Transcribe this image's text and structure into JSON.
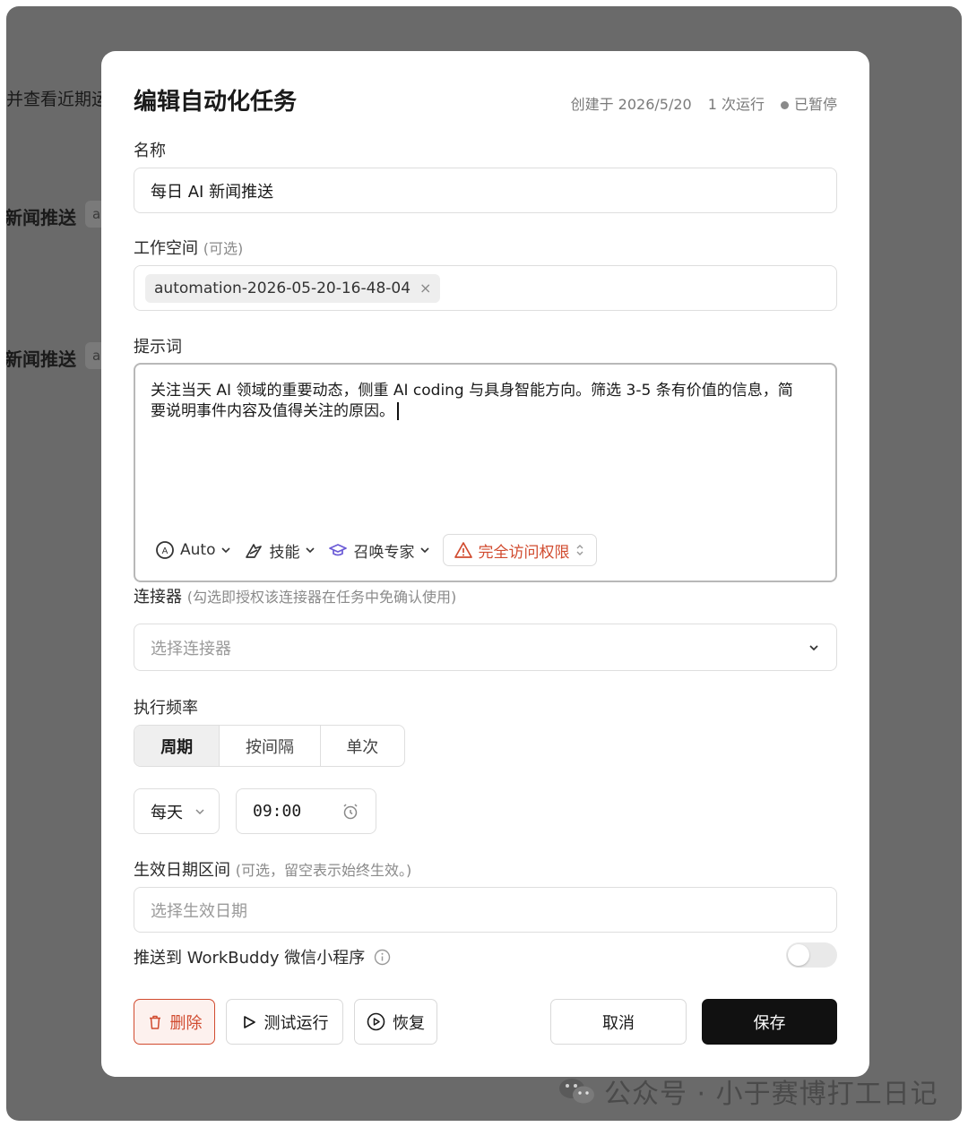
{
  "background": {
    "text_top": "并查看近期运",
    "item1_name": "新闻推送",
    "item1_chip": "a",
    "item2_name": "新闻推送",
    "item2_chip": "a"
  },
  "watermark": "公众号 · 小于赛博打工日记",
  "modal": {
    "title": "编辑自动化任务",
    "meta": {
      "created": "创建于 2026/5/20",
      "runs": "1 次运行",
      "status": "已暂停"
    },
    "name_field": {
      "label": "名称",
      "value": "每日 AI 新闻推送"
    },
    "workspace_field": {
      "label": "工作空间",
      "hint": "(可选)",
      "chip": "automation-2026-05-20-16-48-04",
      "chip_remove": "×"
    },
    "prompt_field": {
      "label": "提示词",
      "value": "关注当天 AI 领域的重要动态，侧重 AI coding 与具身智能方向。筛选 3-5 条有价值的信息，简要说明事件内容及值得关注的原因。",
      "toolbar": {
        "model": "Auto",
        "skills": "技能",
        "expert": "召唤专家",
        "permission": "完全访问权限"
      }
    },
    "connector_field": {
      "label": "连接器",
      "hint": "(勾选即授权该连接器在任务中免确认使用)",
      "placeholder": "选择连接器"
    },
    "frequency": {
      "label": "执行频率",
      "tabs": [
        "周期",
        "按间隔",
        "单次"
      ],
      "active_tab": "周期",
      "period": "每天",
      "time": "09:00"
    },
    "date_range": {
      "label": "生效日期区间",
      "hint": "(可选，留空表示始终生效。)",
      "placeholder": "选择生效日期"
    },
    "push": {
      "label": "推送到 WorkBuddy 微信小程序",
      "enabled": false
    },
    "buttons": {
      "delete": "删除",
      "test_run": "测试运行",
      "resume": "恢复",
      "cancel": "取消",
      "save": "保存"
    }
  },
  "colors": {
    "danger": "#d14b2f",
    "primary": "#111111",
    "overlay": "#6a6a6a"
  }
}
